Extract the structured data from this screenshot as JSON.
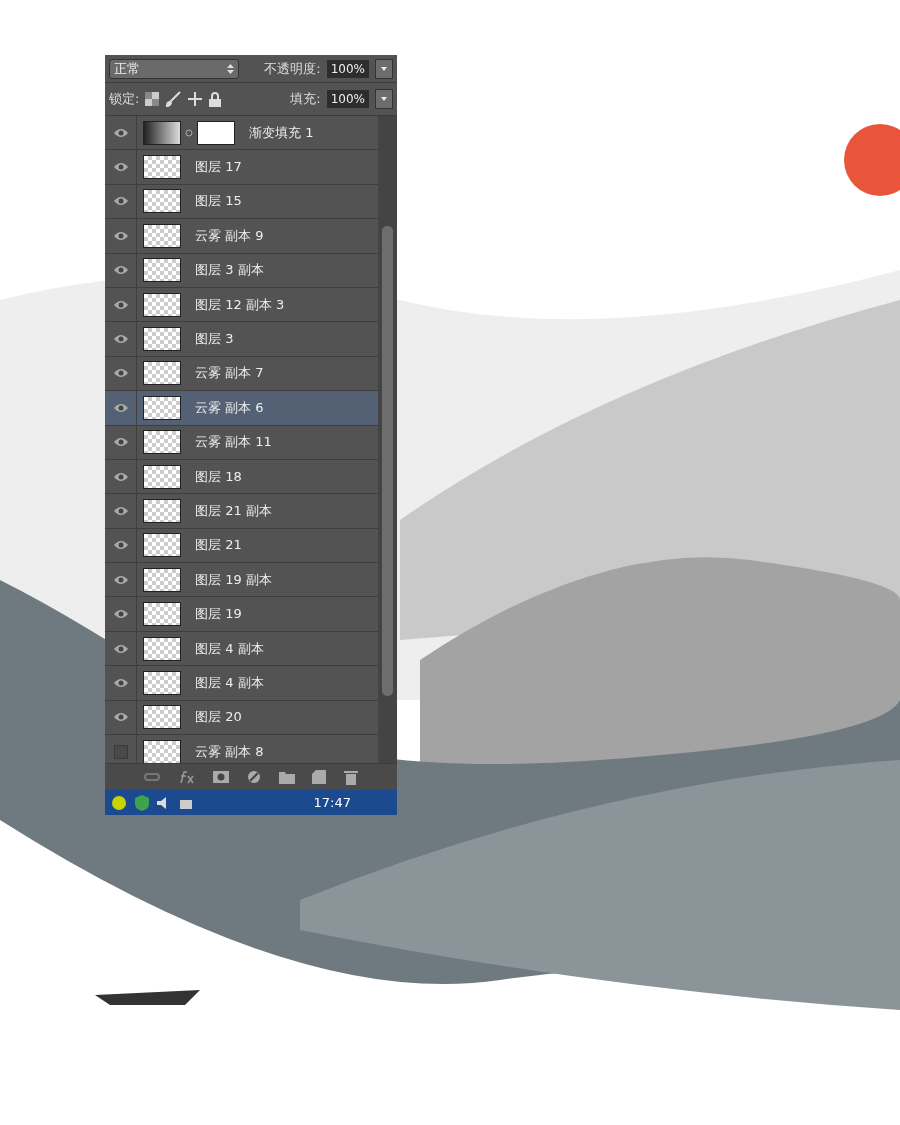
{
  "panel": {
    "blend_mode": "正常",
    "opacity_label": "不透明度:",
    "opacity": "100%",
    "lock_label": "锁定:",
    "fill_label": "填充:",
    "fill": "100%"
  },
  "layers": [
    {
      "name": "渐变填充 1",
      "kind": "gradient",
      "visible": true,
      "selected": false
    },
    {
      "name": "图层 17",
      "kind": "pixel",
      "visible": true,
      "selected": false
    },
    {
      "name": "图层 15",
      "kind": "pixel",
      "visible": true,
      "selected": false
    },
    {
      "name": "云雾 副本 9",
      "kind": "pixel",
      "visible": true,
      "selected": false
    },
    {
      "name": "图层 3 副本",
      "kind": "pixel",
      "visible": true,
      "selected": false
    },
    {
      "name": "图层 12 副本 3",
      "kind": "pixel",
      "visible": true,
      "selected": false
    },
    {
      "name": "图层 3",
      "kind": "pixel",
      "visible": true,
      "selected": false
    },
    {
      "name": "云雾 副本 7",
      "kind": "pixel",
      "visible": true,
      "selected": false
    },
    {
      "name": "云雾 副本 6",
      "kind": "pixel",
      "visible": true,
      "selected": true
    },
    {
      "name": "云雾 副本 11",
      "kind": "pixel",
      "visible": true,
      "selected": false
    },
    {
      "name": "图层 18",
      "kind": "pixel",
      "visible": true,
      "selected": false
    },
    {
      "name": "图层 21 副本",
      "kind": "pixel",
      "visible": true,
      "selected": false
    },
    {
      "name": "图层 21",
      "kind": "pixel",
      "visible": true,
      "selected": false
    },
    {
      "name": "图层 19 副本",
      "kind": "pixel",
      "visible": true,
      "selected": false
    },
    {
      "name": "图层 19",
      "kind": "pixel",
      "visible": true,
      "selected": false
    },
    {
      "name": "图层 4 副本",
      "kind": "pixel",
      "visible": true,
      "selected": false
    },
    {
      "name": "图层 4 副本",
      "kind": "pixel",
      "visible": true,
      "selected": false
    },
    {
      "name": "图层 20",
      "kind": "pixel",
      "visible": true,
      "selected": false
    },
    {
      "name": "云雾 副本 8",
      "kind": "pixel",
      "visible": false,
      "selected": false
    }
  ],
  "taskbar": {
    "time": "17:47"
  }
}
